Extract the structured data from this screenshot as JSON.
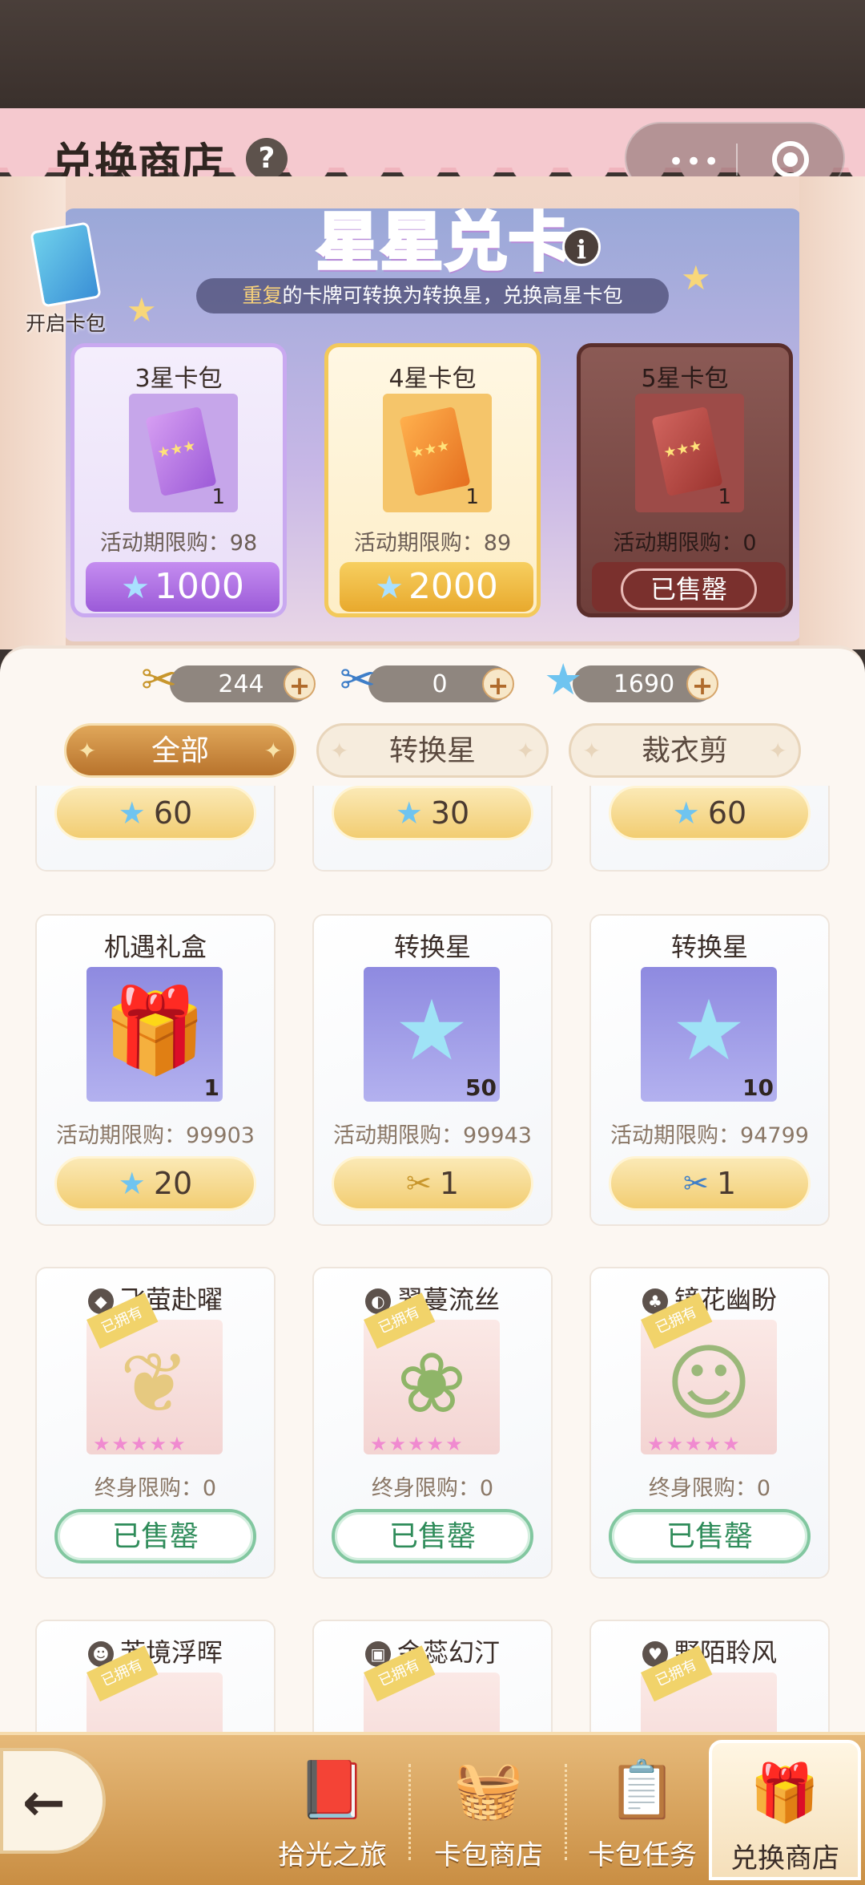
{
  "header": {
    "title": "兑换商店",
    "help_icon": "question-icon",
    "capsule": {
      "more_icon": "more-dots-icon",
      "close_icon": "target-close-icon",
      "dots": "•••"
    }
  },
  "banner": {
    "logo": "星星兑卡",
    "info_icon": "info-icon",
    "subtitle_highlight": "重复",
    "subtitle_rest": "的卡牌可转换为转换星，兑换高星卡包",
    "open_pack_label": "开启卡包"
  },
  "packs": [
    {
      "name": "3星卡包",
      "qty": "1",
      "limit": "活动期限购：98",
      "price": "1000",
      "price_icon": "blue-star-icon"
    },
    {
      "name": "4星卡包",
      "qty": "1",
      "limit": "活动期限购：89",
      "price": "2000",
      "price_icon": "blue-star-icon"
    },
    {
      "name": "5星卡包",
      "qty": "1",
      "limit": "活动期限购：0",
      "status": "已售罄"
    }
  ],
  "currency": [
    {
      "icon": "gold-scissors-icon",
      "value": "244"
    },
    {
      "icon": "blue-scissors-icon",
      "value": "0"
    },
    {
      "icon": "blue-star-icon",
      "value": "1690"
    }
  ],
  "tabs": [
    {
      "label": "全部",
      "active": true
    },
    {
      "label": "转换星",
      "active": false
    },
    {
      "label": "裁衣剪",
      "active": false
    }
  ],
  "cards_top_partial": [
    {
      "price": "60",
      "price_icon": "blue-star-icon"
    },
    {
      "price": "30",
      "price_icon": "blue-star-icon"
    },
    {
      "price": "60",
      "price_icon": "blue-star-icon"
    }
  ],
  "cards_row2": [
    {
      "name": "机遇礼盒",
      "qty": "1",
      "limit": "活动期限购：99903",
      "price": "20",
      "price_icon": "blue-star-icon",
      "image_icon": "mystery-gift-box-icon"
    },
    {
      "name": "转换星",
      "qty": "50",
      "limit": "活动期限购：99943",
      "price": "1",
      "price_icon": "gold-scissors-icon",
      "image_icon": "blue-star-icon"
    },
    {
      "name": "转换星",
      "qty": "10",
      "limit": "活动期限购：94799",
      "price": "1",
      "price_icon": "blue-scissors-icon",
      "image_icon": "blue-star-icon"
    }
  ],
  "cards_row3": [
    {
      "name": "飞萤赴曜",
      "owned": "已拥有",
      "limit": "终身限购：0",
      "status": "已售罄",
      "name_icon": "outfit-icon"
    },
    {
      "name": "翠蔓流丝",
      "owned": "已拥有",
      "limit": "终身限购：0",
      "status": "已售罄",
      "name_icon": "hair-icon"
    },
    {
      "name": "镜花幽盼",
      "owned": "已拥有",
      "limit": "终身限购：0",
      "status": "已售罄",
      "name_icon": "makeup-icon"
    }
  ],
  "cards_row4": [
    {
      "name": "芳境浮晖",
      "owned": "已拥有",
      "name_icon": "face-icon"
    },
    {
      "name": "金蕊幻汀",
      "owned": "已拥有",
      "name_icon": "frame-icon"
    },
    {
      "name": "野陌聆风",
      "owned": "已拥有",
      "name_icon": "accessory-icon"
    }
  ],
  "rarity": "★★★★★",
  "bottom_nav": [
    {
      "label": "拾光之旅",
      "icon": "journey-book-icon"
    },
    {
      "label": "卡包商店",
      "icon": "card-basket-icon"
    },
    {
      "label": "卡包任务",
      "icon": "task-clipboard-icon"
    },
    {
      "label": "兑换商店",
      "icon": "exchange-shop-icon",
      "active": true
    }
  ]
}
